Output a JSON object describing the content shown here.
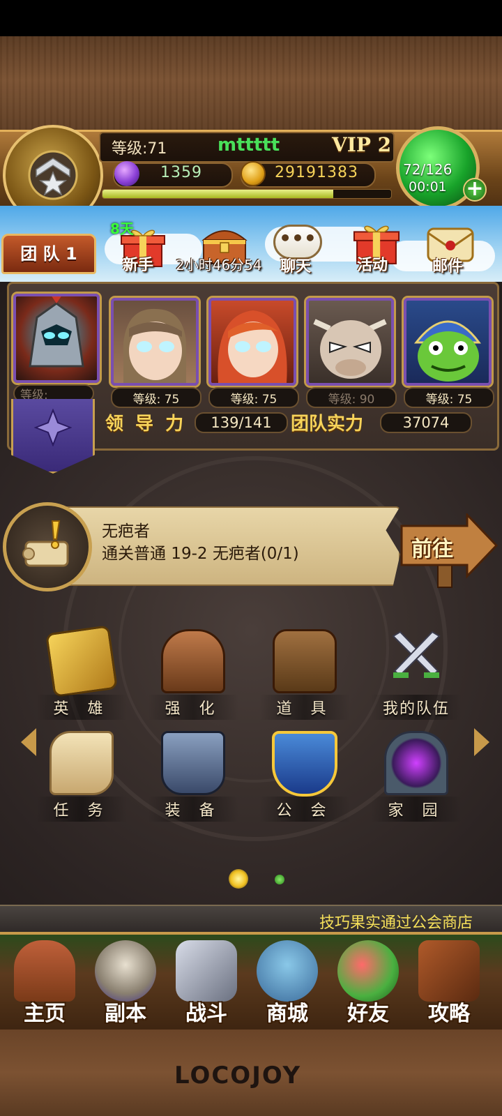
{
  "player": {
    "level_text": "等级:71",
    "name": "mttttt",
    "vip": "VIP 2",
    "gems": "1359",
    "gold": "29191383",
    "stamina": "72/126",
    "stamina_timer": "00:01",
    "exp_progress": 0.8
  },
  "team_tab": "团 队 1",
  "top_menu": {
    "newbie_badge": "8天",
    "newbie": "新手",
    "chest": "2小时46分54",
    "chat": "聊天",
    "activity": "活动",
    "mail": "邮件"
  },
  "team": {
    "leader_level": "等级:",
    "heroes": [
      {
        "level": "等级: 75"
      },
      {
        "level": "等级: 75"
      },
      {
        "level": "等级: 90"
      },
      {
        "level": "等级: 75"
      }
    ],
    "leadership_label": "领 导 力",
    "leadership_value": "139/141",
    "power_label": "团队实力",
    "power_value": "37074"
  },
  "quest": {
    "title": "无疤者",
    "desc": "通关普通 19-2 无疤者(0/1)",
    "go": "前往"
  },
  "grid": [
    {
      "label": "英 雄",
      "icon": "scroll-shield-icon"
    },
    {
      "label": "强 化",
      "icon": "forge-door-icon"
    },
    {
      "label": "道 具",
      "icon": "backpack-icon"
    },
    {
      "label": "我的队伍",
      "icon": "crossed-swords-icon"
    },
    {
      "label": "任 务",
      "icon": "quest-scroll-icon"
    },
    {
      "label": "装 备",
      "icon": "anvil-icon"
    },
    {
      "label": "公 会",
      "icon": "guild-shield-icon"
    },
    {
      "label": "家 园",
      "icon": "portal-gate-icon"
    }
  ],
  "ticker": "技巧果实通过公会商店",
  "nav": [
    {
      "label": "主页",
      "icon": "house-icon"
    },
    {
      "label": "副本",
      "icon": "skull-icon"
    },
    {
      "label": "战斗",
      "icon": "sword-axe-icon"
    },
    {
      "label": "商城",
      "icon": "monster-shop-icon"
    },
    {
      "label": "好友",
      "icon": "friends-icon"
    },
    {
      "label": "攻略",
      "icon": "book-gear-icon"
    }
  ],
  "brand": "LOCOJOY",
  "colors": {
    "gold": "#f6d35a",
    "vip": "#ffe9a0",
    "name": "#49e05a"
  }
}
